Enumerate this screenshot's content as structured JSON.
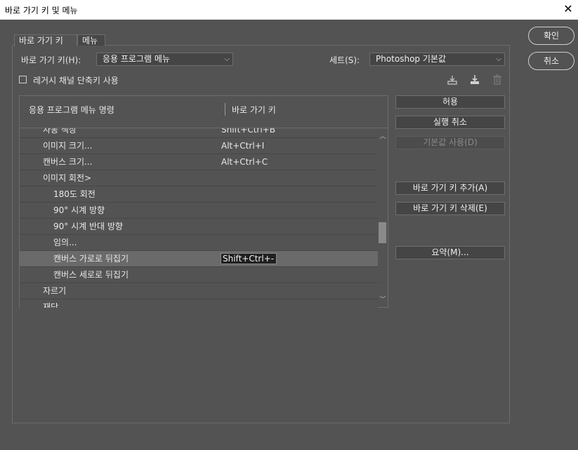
{
  "window": {
    "title": "바로 가기 키 및 메뉴",
    "close_symbol": "✕"
  },
  "tabs": [
    {
      "label": "바로 가기 키",
      "active": true
    },
    {
      "label": "메뉴",
      "active": false
    }
  ],
  "shortcuts_for": {
    "label": "바로 가기 키(H):",
    "value": "응용 프로그램 메뉴"
  },
  "set": {
    "label": "세트(S):",
    "value": "Photoshop 기본값"
  },
  "legacy_checkbox": {
    "label": "레거시 채널 단축키 사용",
    "checked": false
  },
  "set_icons": [
    "save-set-icon",
    "save-set-as-icon",
    "delete-set-icon"
  ],
  "table": {
    "header_command": "응용 프로그램 메뉴 명령",
    "header_shortcut": "바로 가기 키",
    "rows": [
      {
        "command": "자동 색상",
        "shortcut": "Shift+Ctrl+B",
        "level": 1
      },
      {
        "command": "이미지 크기...",
        "shortcut": "Alt+Ctrl+I",
        "level": 1
      },
      {
        "command": "캔버스 크기...",
        "shortcut": "Alt+Ctrl+C",
        "level": 1
      },
      {
        "command": "이미지 회전>",
        "shortcut": "",
        "level": 1
      },
      {
        "command": "180도 회전",
        "shortcut": "",
        "level": 2
      },
      {
        "command": "90° 시계 방향",
        "shortcut": "",
        "level": 2
      },
      {
        "command": "90° 시계 반대 방향",
        "shortcut": "",
        "level": 2
      },
      {
        "command": "임의...",
        "shortcut": "",
        "level": 2
      },
      {
        "command": "캔버스 가로로 뒤집기",
        "shortcut": "Shift+Ctrl+-",
        "level": 2,
        "selected": true
      },
      {
        "command": "캔버스 세로로 뒤집기",
        "shortcut": "",
        "level": 2
      },
      {
        "command": "자르기",
        "shortcut": "",
        "level": 1
      },
      {
        "command": "재단",
        "shortcut": "",
        "level": 1
      }
    ]
  },
  "right_buttons": {
    "accept": "허용",
    "undo": "실행 취소",
    "use_default": "기본값 사용(D)",
    "add_shortcut": "바로 가기 키 추가(A)",
    "delete_shortcut": "바로 가기 키 삭제(E)",
    "summarize": "요약(M)..."
  },
  "dialog_buttons": {
    "ok": "확인",
    "cancel": "취소"
  },
  "colors": {
    "background": "#535353",
    "selected_row": "#6a6a6a",
    "titlebar": "#ffffff"
  }
}
